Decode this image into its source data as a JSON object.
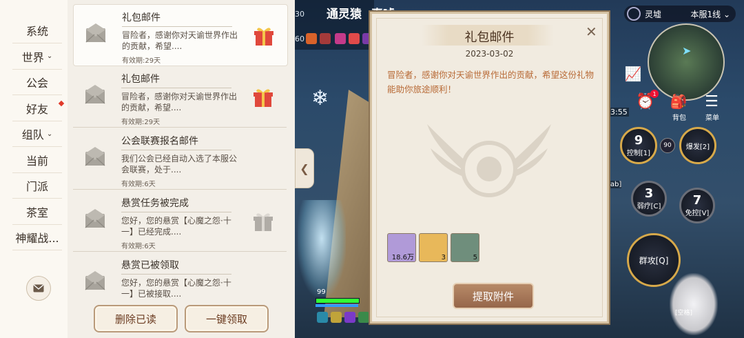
{
  "nav": {
    "items": [
      {
        "label": "系统",
        "chevron": false,
        "dot": false
      },
      {
        "label": "世界",
        "chevron": true,
        "dot": false
      },
      {
        "label": "公会",
        "chevron": false,
        "dot": false
      },
      {
        "label": "好友",
        "chevron": false,
        "dot": true
      },
      {
        "label": "组队",
        "chevron": true,
        "dot": false
      },
      {
        "label": "当前",
        "chevron": false,
        "dot": false
      },
      {
        "label": "门派",
        "chevron": false,
        "dot": false
      },
      {
        "label": "茶室",
        "chevron": false,
        "dot": false
      },
      {
        "label": "神耀战...",
        "chevron": false,
        "dot": false
      }
    ]
  },
  "mails": [
    {
      "title": "礼包邮件",
      "body": "冒险者，感谢你对天谕世界作出的贡献，希望....",
      "expiry": "有效期:29天",
      "gift": "red"
    },
    {
      "title": "礼包邮件",
      "body": "冒险者，感谢你对天谕世界作出的贡献，希望....",
      "expiry": "有效期:29天",
      "gift": "red"
    },
    {
      "title": "公会联赛报名邮件",
      "body": "我们公会已经自动入选了本服公会联赛，处于....",
      "expiry": "有效期:6天",
      "gift": "none"
    },
    {
      "title": "悬赏任务被完成",
      "body": "您好，您的悬赏【心魔之怨·十一】已经完成....",
      "expiry": "有效期:6天",
      "gift": "grey"
    },
    {
      "title": "悬赏已被领取",
      "body": "您好，您的悬赏【心魔之怨·十一】已被接取....",
      "expiry": "",
      "gift": "none"
    }
  ],
  "buttons": {
    "delete_read": "删除已读",
    "claim_all": "一键领取"
  },
  "detail": {
    "title": "礼包邮件",
    "date": "2023-03-02",
    "text": "冒险者，感谢你对天谕世界作出的贡献，希望这份礼物能助你旅途顺利！",
    "attachments": [
      {
        "icon": "scroll-item-icon",
        "count": "18.6万",
        "color": "#b09ad8"
      },
      {
        "icon": "talisman-item-icon",
        "count": "3",
        "color": "#e8b85a"
      },
      {
        "icon": "ore-item-icon",
        "count": "5",
        "color": "#6f8e7c"
      }
    ],
    "extract_label": "提取附件"
  },
  "hud": {
    "character_name": "通灵猿",
    "name_suffix": "真嘘",
    "level_30": "30",
    "level_60": "60",
    "region": "灵墟",
    "server_line": "本服1线",
    "time": "3:55",
    "tab_label": "[ab]",
    "hp_value": "99",
    "bag_label": "背包",
    "menu_label": "菜单",
    "alarm_badge": "1",
    "skills": [
      {
        "num": "9",
        "label": "控制[1]",
        "style": "gold"
      },
      {
        "num": "",
        "label": "爆发[2]",
        "style": "gold"
      },
      {
        "num": "3",
        "label": "弱疗[C]",
        "style": "grey"
      },
      {
        "num": "7",
        "label": "免控[V]",
        "style": "grey"
      },
      {
        "num": "",
        "label": "群攻[Q]",
        "style": "gold"
      }
    ],
    "small_badge": "90",
    "bunny_label": "[空格]"
  }
}
